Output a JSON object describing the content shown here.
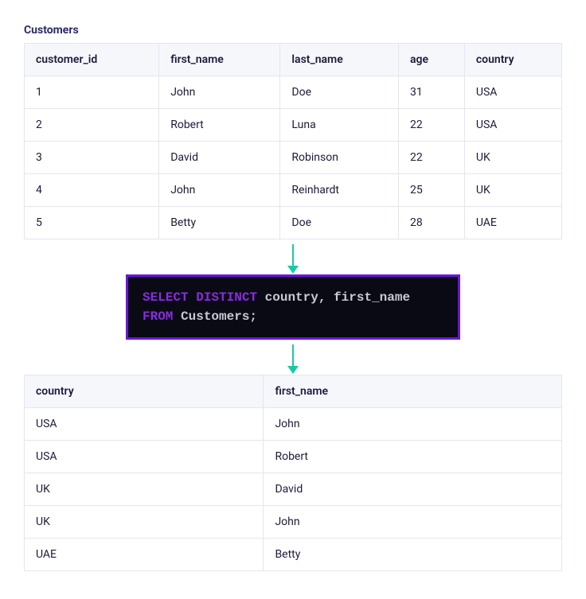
{
  "source_table": {
    "title": "Customers",
    "headers": [
      "customer_id",
      "first_name",
      "last_name",
      "age",
      "country"
    ],
    "rows": [
      [
        "1",
        "John",
        "Doe",
        "31",
        "USA"
      ],
      [
        "2",
        "Robert",
        "Luna",
        "22",
        "USA"
      ],
      [
        "3",
        "David",
        "Robinson",
        "22",
        "UK"
      ],
      [
        "4",
        "John",
        "Reinhardt",
        "25",
        "UK"
      ],
      [
        "5",
        "Betty",
        "Doe",
        "28",
        "UAE"
      ]
    ]
  },
  "sql": {
    "kw_select": "SELECT",
    "kw_distinct": "DISTINCT",
    "cols": "country, first_name",
    "kw_from": "FROM",
    "table": "Customers;"
  },
  "result_table": {
    "headers": [
      "country",
      "first_name"
    ],
    "rows": [
      [
        "USA",
        "John"
      ],
      [
        "USA",
        "Robert"
      ],
      [
        "UK",
        "David"
      ],
      [
        "UK",
        "John"
      ],
      [
        "UAE",
        "Betty"
      ]
    ]
  }
}
